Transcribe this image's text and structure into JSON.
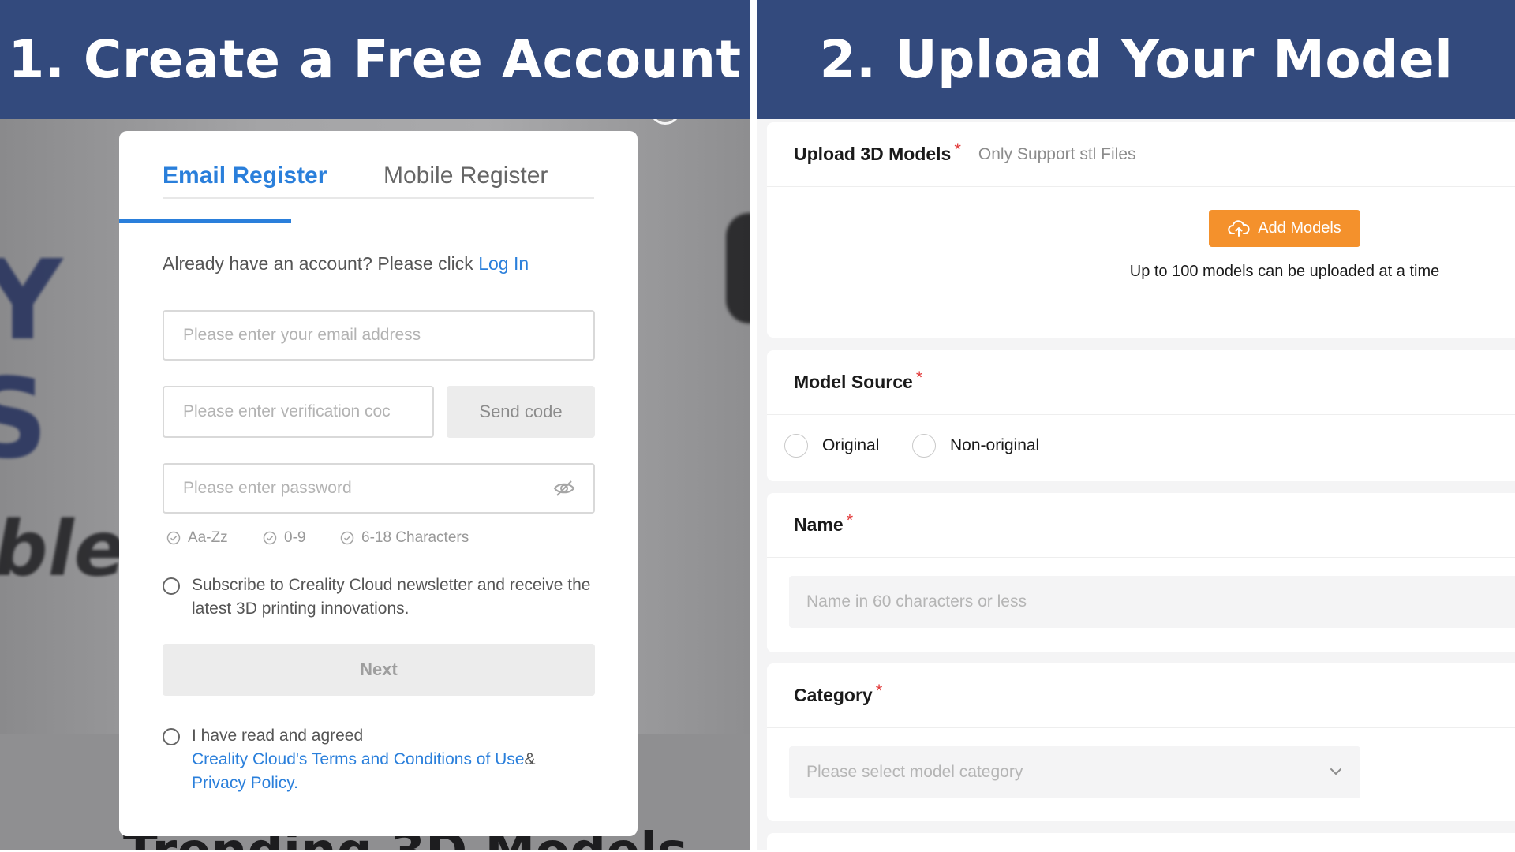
{
  "banners": {
    "left": "1. Create a Free Account",
    "right": "2. Upload Your Model"
  },
  "background": {
    "glyph_1": "Y",
    "glyph_2": "S",
    "glyph_3": "ble",
    "trending": "Trending 3D Models"
  },
  "register": {
    "tabs": {
      "email": "Email Register",
      "mobile": "Mobile Register"
    },
    "login_prompt": "Already have an account? Please click",
    "login_link": "Log In",
    "email_placeholder": "Please enter your email address",
    "code_placeholder": "Please enter verification coc",
    "send_code_label": "Send code",
    "password_placeholder": "Please enter password",
    "password_rules": [
      "Aa-Zz",
      "0-9",
      "6-18 Characters"
    ],
    "subscribe_text": "Subscribe to Creality Cloud newsletter and receive the latest 3D printing innovations.",
    "next_label": "Next",
    "agree_text": "I have read and agreed",
    "terms_link": "Creality Cloud's Terms and Conditions of Use",
    "ampersand": "&",
    "privacy_link": "Privacy Policy."
  },
  "upload": {
    "section_title": "Upload 3D Models",
    "required_mark": "*",
    "hint": "Only Support stl Files",
    "add_models_label": "Add Models",
    "limit_text": "Up to 100 models can be uploaded at a time"
  },
  "model_source": {
    "title": "Model Source",
    "options": [
      "Original",
      "Non-original"
    ]
  },
  "name_field": {
    "title": "Name",
    "placeholder": "Name in 60 characters or less"
  },
  "category": {
    "title": "Category",
    "placeholder": "Please select model category"
  },
  "colors": {
    "banner": "#334a7d",
    "link_blue": "#2a7fdb",
    "accent_orange": "#f4912c",
    "required_red": "#e23b3b"
  },
  "icons": {
    "password_toggle": "eye-off-icon",
    "rule_check": "check-circle-icon",
    "upload": "cloud-upload-icon",
    "dropdown": "chevron-down-icon"
  }
}
